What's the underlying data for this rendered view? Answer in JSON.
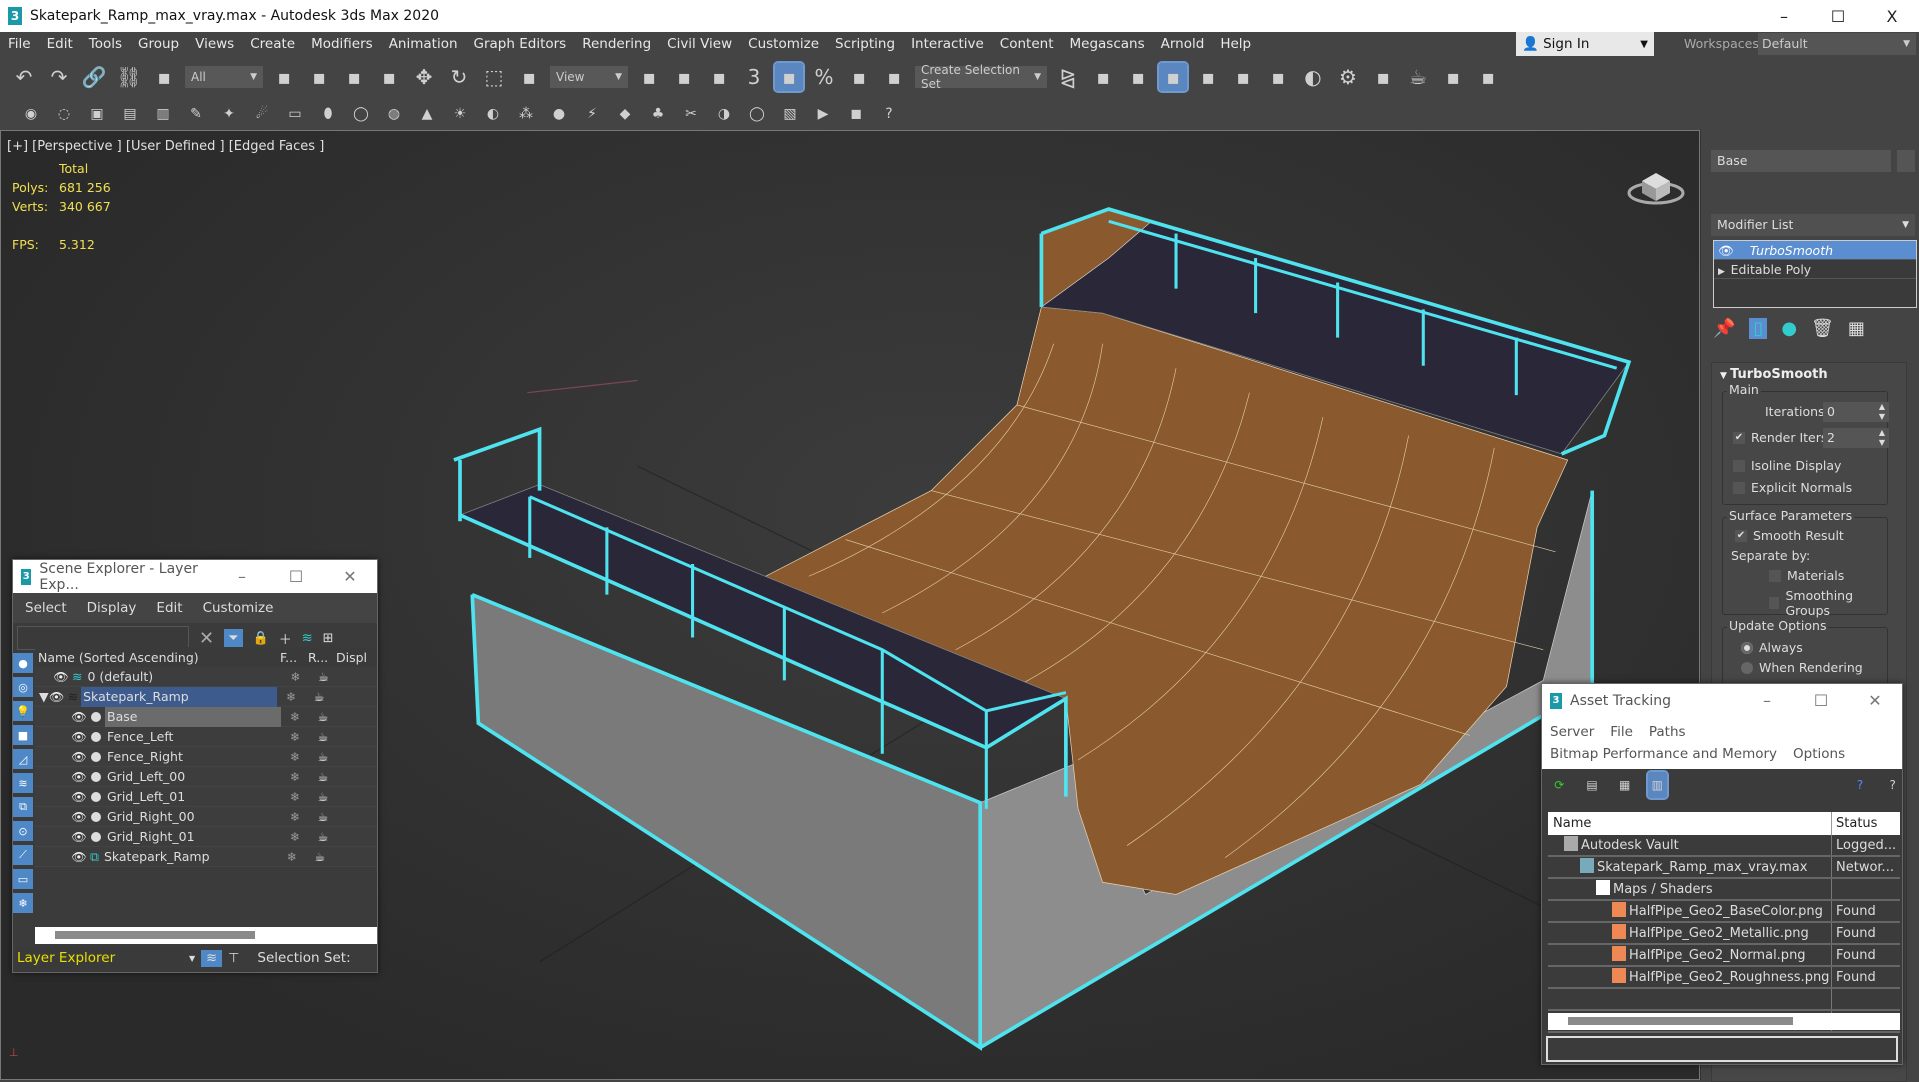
{
  "titlebar": {
    "title": "Skatepark_Ramp_max_vray.max - Autodesk 3ds Max 2020",
    "logo": "3",
    "minimize": "–",
    "maximize": "☐",
    "close": "X"
  },
  "menu": [
    "File",
    "Edit",
    "Tools",
    "Group",
    "Views",
    "Create",
    "Modifiers",
    "Animation",
    "Graph Editors",
    "Rendering",
    "Civil View",
    "Customize",
    "Scripting",
    "Interactive",
    "Content",
    "Megascans",
    "Arnold",
    "Help"
  ],
  "signin": {
    "label": "Sign In",
    "icon": "user-icon"
  },
  "workspaces": {
    "label": "Workspaces:",
    "value": "Default"
  },
  "toolbar": {
    "selection_filter": "All",
    "ref_coord": "View",
    "selection_set": "Create Selection Set",
    "icons1a": [
      "undo-icon",
      "redo-icon",
      "link-icon",
      "unlink-icon",
      "bind-spacewarp-icon"
    ],
    "icons1b": [
      "select-object-icon",
      "select-by-name-icon",
      "rect-region-icon",
      "window-crossing-icon",
      "move-icon",
      "rotate-icon",
      "scale-icon",
      "place-icon"
    ],
    "icons1c": [
      "pivot-icon",
      "manipulate-icon",
      "keyboard-shortcut-icon",
      "snap-3d-icon",
      "angle-snap-icon",
      "percent-snap-icon",
      "spinner-snap-icon",
      "edit-named-sets-icon"
    ],
    "icons1d": [
      "mirror-icon",
      "align-icon",
      "layer-manager-icon",
      "ribbon-icon",
      "toggle-scene-explorer-icon",
      "curve-editor-icon",
      "schematic-view-icon",
      "material-editor-icon",
      "render-setup-icon",
      "rendered-frame-icon",
      "render-icon",
      "render-online-icon",
      "render-cloud-icon"
    ],
    "icons2": [
      "vray-light-icon",
      "vray-sun-icon",
      "vray-fb-icon",
      "vray-settings-icon",
      "vray-log-icon",
      "vray-ies-icon",
      "vray-proxy-icon",
      "vray-fur-icon",
      "vray-plane-icon",
      "vray-sphere-icon",
      "vray-dome-icon",
      "vray-mesh-icon",
      "vray-cone-icon",
      "vray-sunlight-icon",
      "vray-ambient-icon",
      "vray-displace-icon",
      "vray-material-icon",
      "vray-scatter-icon",
      "vray-decal-icon",
      "vray-clipper-icon",
      "vray-enmesh-icon",
      "vray-fur2-icon",
      "vray-vrscene-icon",
      "vray-lister-icon",
      "vray-ipr-icon",
      "vray-cosmos-icon",
      "vray-help-icon"
    ]
  },
  "viewport": {
    "label": "[+] [Perspective ] [User Defined ] [Edged Faces ]",
    "stats_header": "Total",
    "polys_label": "Polys:",
    "polys": "681 256",
    "verts_label": "Verts:",
    "verts": "340 667",
    "fps_label": "FPS:",
    "fps": "5.312",
    "colors": {
      "wood": "#8a5a2e",
      "selection": "#4fe3f0",
      "wall": "#8a8a8a",
      "deck": "#2a2838"
    }
  },
  "command_panel": {
    "object_name": "Base",
    "modifier_list": "Modifier List",
    "stack": [
      "TurboSmooth",
      "Editable Poly"
    ],
    "rollout_title": "TurboSmooth",
    "main_group": "Main",
    "iterations_label": "Iterations:",
    "iterations": "0",
    "render_iters_label": "Render Iters:",
    "render_iters": "2",
    "isoline": "Isoline Display",
    "explicit_normals": "Explicit Normals",
    "surface_group": "Surface Parameters",
    "smooth_result": "Smooth Result",
    "separate_by": "Separate by:",
    "materials": "Materials",
    "smoothing_groups": "Smoothing Groups",
    "update_group": "Update Options",
    "always": "Always",
    "when_rendering": "When Rendering"
  },
  "scene_explorer": {
    "title": "Scene Explorer - Layer Exp...",
    "menu": [
      "Select",
      "Display",
      "Edit",
      "Customize"
    ],
    "columns": [
      "Name (Sorted Ascending)",
      "F...",
      "R...",
      "Displ"
    ],
    "rows": [
      {
        "name": "0 (default)",
        "level": 0,
        "type": "layer"
      },
      {
        "name": "Skatepark_Ramp",
        "level": 0,
        "type": "layer-selected"
      },
      {
        "name": "Base",
        "level": 1,
        "type": "object-selected"
      },
      {
        "name": "Fence_Left",
        "level": 1,
        "type": "object"
      },
      {
        "name": "Fence_Right",
        "level": 1,
        "type": "object"
      },
      {
        "name": "Grid_Left_00",
        "level": 1,
        "type": "object"
      },
      {
        "name": "Grid_Left_01",
        "level": 1,
        "type": "object"
      },
      {
        "name": "Grid_Right_00",
        "level": 1,
        "type": "object"
      },
      {
        "name": "Grid_Right_01",
        "level": 1,
        "type": "object"
      },
      {
        "name": "Skatepark_Ramp",
        "level": 1,
        "type": "group"
      }
    ],
    "footer_mode": "Layer Explorer",
    "selection_set": "Selection Set:"
  },
  "asset_tracking": {
    "title": "Asset Tracking",
    "menu1": [
      "Server",
      "File",
      "Paths"
    ],
    "menu2": [
      "Bitmap Performance and Memory",
      "Options"
    ],
    "columns": [
      "Name",
      "Status"
    ],
    "rows": [
      {
        "name": "Autodesk Vault",
        "status": "Logged...",
        "level": 1
      },
      {
        "name": "Skatepark_Ramp_max_vray.max",
        "status": "Networ...",
        "level": 2
      },
      {
        "name": "Maps / Shaders",
        "status": "",
        "level": 3
      },
      {
        "name": "HalfPipe_Geo2_BaseColor.png",
        "status": "Found",
        "level": 4
      },
      {
        "name": "HalfPipe_Geo2_Metallic.png",
        "status": "Found",
        "level": 4
      },
      {
        "name": "HalfPipe_Geo2_Normal.png",
        "status": "Found",
        "level": 4
      },
      {
        "name": "HalfPipe_Geo2_Roughness.png",
        "status": "Found",
        "level": 4
      }
    ]
  }
}
